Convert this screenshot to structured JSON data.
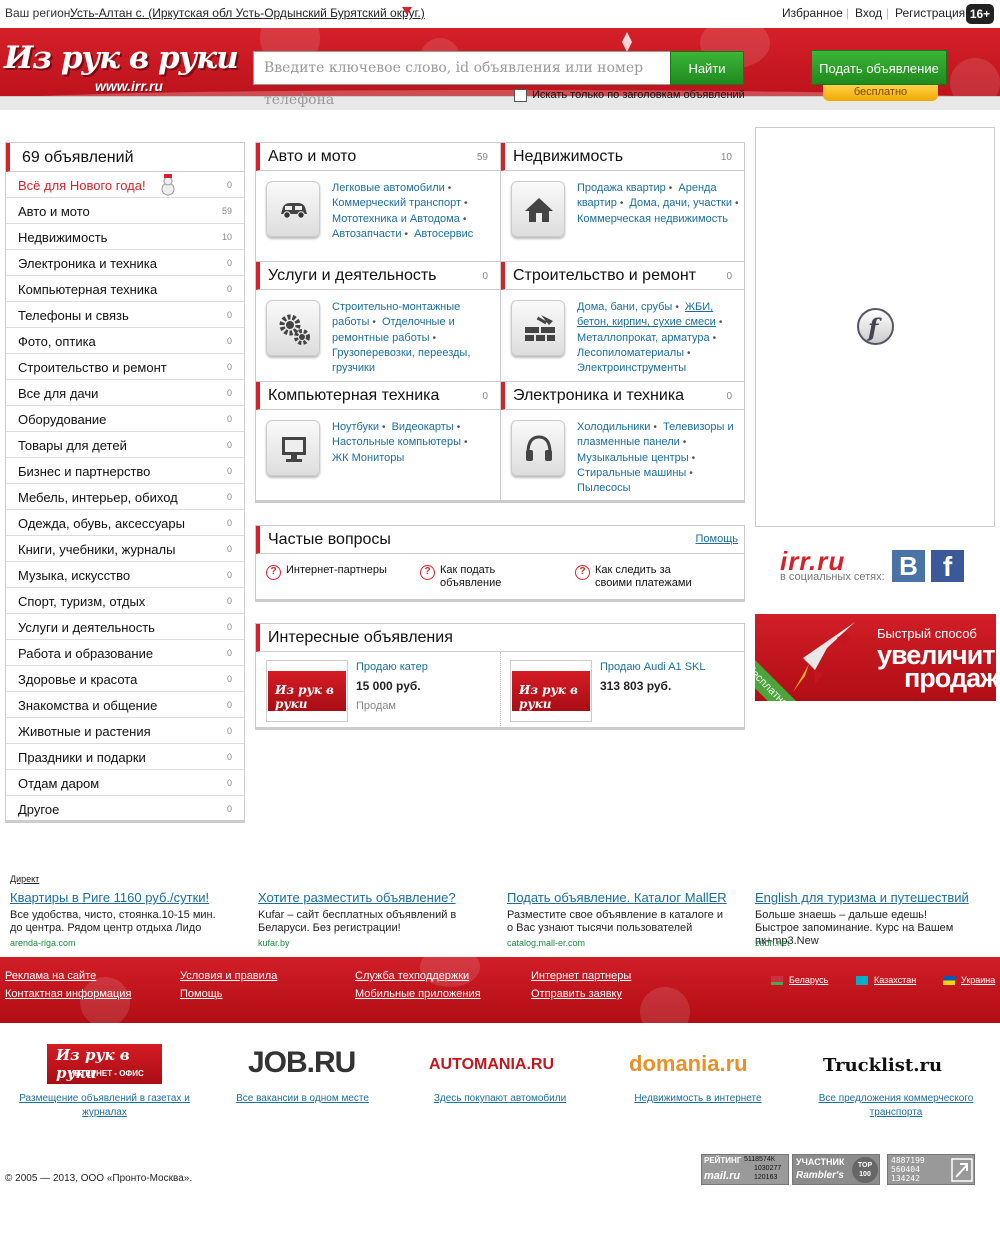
{
  "topbar": {
    "region_label": "Ваш регион:",
    "region_value": "Усть-Алтан с. (Иркутская обл Усть-Ордынский Бурятский округ.)",
    "favorites": "Избранное",
    "login": "Вход",
    "register": "Регистрация",
    "age_rating": "16+",
    "separator": "|"
  },
  "header": {
    "logo_text": "Из рук в руки",
    "logo_url": "www.irr.ru",
    "search_placeholder": "Введите ключевое слово, id объявления или номер телефона",
    "search_button": "Найти",
    "post_button": "Подать объявление",
    "post_free": "бесплатно",
    "title_only_label": "Искать только по заголовкам объявлений",
    "title_only_checked": false
  },
  "sidebar": {
    "total": "69 объявлений",
    "items": [
      {
        "label": "Всё для Нового года!",
        "count": "0"
      },
      {
        "label": "Авто и мото",
        "count": "59"
      },
      {
        "label": "Недвижимость",
        "count": "10"
      },
      {
        "label": "Электроника и техника",
        "count": "0"
      },
      {
        "label": "Компьютерная техника",
        "count": "0"
      },
      {
        "label": "Телефоны и связь",
        "count": "0"
      },
      {
        "label": "Фото, оптика",
        "count": "0"
      },
      {
        "label": "Строительство и ремонт",
        "count": "0"
      },
      {
        "label": "Все для дачи",
        "count": "0"
      },
      {
        "label": "Оборудование",
        "count": "0"
      },
      {
        "label": "Товары для детей",
        "count": "0"
      },
      {
        "label": "Бизнес и партнерство",
        "count": "0"
      },
      {
        "label": "Мебель, интерьер, обиход",
        "count": "0"
      },
      {
        "label": "Одежда, обувь, аксессуары",
        "count": "0"
      },
      {
        "label": "Книги, учебники, журналы",
        "count": "0"
      },
      {
        "label": "Музыка, искусство",
        "count": "0"
      },
      {
        "label": "Спорт, туризм, отдых",
        "count": "0"
      },
      {
        "label": "Услуги и деятельность",
        "count": "0"
      },
      {
        "label": "Работа и образование",
        "count": "0"
      },
      {
        "label": "Здоровье и красота",
        "count": "0"
      },
      {
        "label": "Знакомства и общение",
        "count": "0"
      },
      {
        "label": "Животные и растения",
        "count": "0"
      },
      {
        "label": "Праздники и подарки",
        "count": "0"
      },
      {
        "label": "Отдам даром",
        "count": "0"
      },
      {
        "label": "Другое",
        "count": "0"
      }
    ]
  },
  "categories": [
    {
      "title": "Авто и мото",
      "count": "59",
      "icon": "car-icon",
      "links": [
        "Легковые автомобили",
        "Коммерческий транспорт",
        "Мототехника и Автодома",
        "Автозапчасти",
        "Автосервис"
      ]
    },
    {
      "title": "Недвижимость",
      "count": "10",
      "icon": "house-icon",
      "links": [
        "Продажа квартир",
        "Аренда квартир",
        "Дома, дачи, участки",
        "Коммерческая недвижимость"
      ]
    },
    {
      "title": "Услуги и деятельность",
      "count": "0",
      "icon": "gears-icon",
      "links": [
        "Строительно-монтажные работы",
        "Отделочные и ремонтные работы",
        "Грузоперевозки, переезды, грузчики"
      ]
    },
    {
      "title": "Строительство и ремонт",
      "count": "0",
      "icon": "bricks-icon",
      "links": [
        "Дома, бани, срубы",
        "ЖБИ, бетон, кирпич, сухие смеси",
        "Металлопрокат, арматура",
        "Лесопиломатериалы",
        "Электроинструменты"
      ]
    },
    {
      "title": "Компьютерная техника",
      "count": "0",
      "icon": "monitor-icon",
      "links": [
        "Ноутбуки",
        "Видеокарты",
        "Настольные компьютеры",
        "ЖК Мониторы"
      ]
    },
    {
      "title": "Электроника и техника",
      "count": "0",
      "icon": "headphones-icon",
      "links": [
        "Холодильники",
        "Телевизоры и плазменные панели",
        "Музыкальные центры",
        "Стиральные машины",
        "Пылесосы"
      ]
    }
  ],
  "faq": {
    "title": "Частые вопросы",
    "help": "Помощь",
    "items": [
      "Интернет-партнеры",
      "Как подать объявление",
      "Как следить за своими платежами"
    ]
  },
  "interesting": {
    "title": "Интересные объявления",
    "thumb_text": "Из рук в руки",
    "items": [
      {
        "name": "Продаю катер",
        "price": "15 000 руб.",
        "note": "Продам"
      },
      {
        "name": "Продаю Audi A1 SKL",
        "price": "313 803 руб.",
        "note": ""
      }
    ]
  },
  "social": {
    "logo": "irr.ru",
    "label": "в социальных сетях:",
    "vk": "В",
    "fb": "f"
  },
  "promo": {
    "line1": "Быстрый способ",
    "line2": "увеличить",
    "line3": "продажи!",
    "ribbon": "бесплатно*"
  },
  "direct": {
    "label": "Директ",
    "ads": [
      {
        "title": "Квартиры в Риге 1160 руб./сутки!",
        "text": "Все удобства, чисто, стоянка.10-15 мин. до центра. Рядом центр отдыха Лидо",
        "url": "arenda-riga.com"
      },
      {
        "title": "Хотите разместить объявление?",
        "text": "Kufar – сайт бесплатных объявлений в Беларуси. Без регистрации!",
        "url": "kufar.by"
      },
      {
        "title": "Подать объявление. Каталог MallER",
        "text": "Разместите свое объявление в каталоге и о Вас узнают тысячи пользователей",
        "url": "catalog.mall-er.com"
      },
      {
        "title": "English для туризма и путешествий",
        "text": "Больше знаешь – дальше едешь! Быстрое запоминание. Курс на Вашем пк+mp3.New",
        "url": "zubri.net"
      }
    ]
  },
  "footer": {
    "col1": [
      "Реклама на сайте",
      "Контактная информация"
    ],
    "col2": [
      "Условия и правила",
      "Помощь"
    ],
    "col3": [
      "Служба техподдержки",
      "Мобильные приложения"
    ],
    "col4": [
      "Интернет партнеры",
      "Отправить заявку"
    ],
    "countries": [
      "Беларусь",
      "Казахстан",
      "Украина"
    ]
  },
  "partners": [
    {
      "logo": "Из рук в руки",
      "sub": "ИНТЕРНЕТ - ОФИС",
      "caption": "Размещение объявлений в газетах и журналах"
    },
    {
      "logo": "JOB.RU",
      "caption": "Все вакансии в одном месте"
    },
    {
      "logo": "AUTOMANIA.RU",
      "caption": "Здесь покупают автомобили"
    },
    {
      "logo": "domania.ru",
      "caption": "Недвижимость в интернете"
    },
    {
      "logo": "Trucklist.ru",
      "caption": "Все предложения коммерческого транспорта"
    }
  ],
  "copyright": "© 2005 — 2013, ООО «Пронто-Москва».",
  "counters": {
    "mail_title": "РЕЙТИНГ",
    "mail_nums": [
      "5118574К",
      "1030277",
      "120163"
    ],
    "mail_name": "mail.ru",
    "rambler_title": "УЧАСТНИК",
    "rambler_name": "Rambler's",
    "rambler_top": "TOP 100",
    "li_nums": [
      "4887199",
      "560404",
      "134242"
    ]
  },
  "colors": {
    "brand_red": "#d4232b",
    "green_button": "#2a9e27",
    "link_blue": "#1a6e9e"
  }
}
